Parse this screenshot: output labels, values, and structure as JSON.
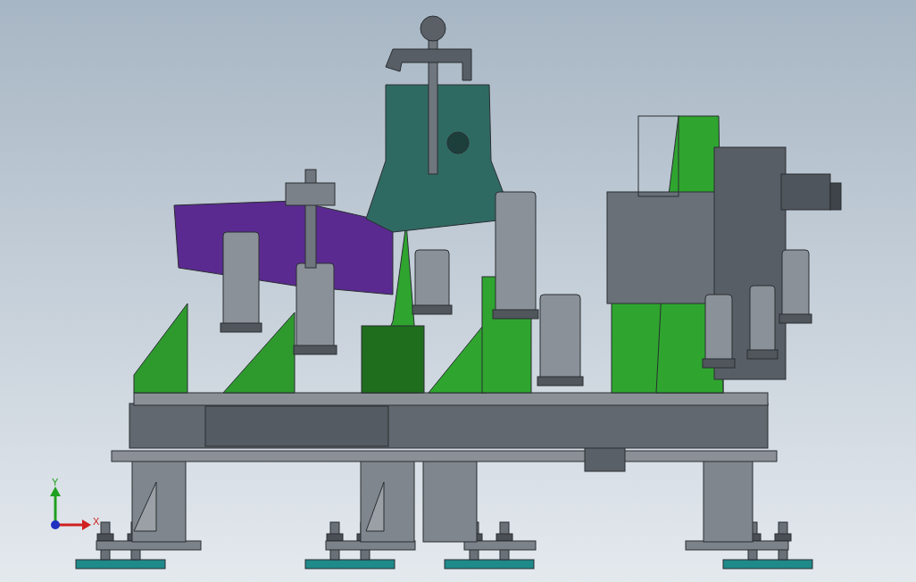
{
  "viewport": {
    "triad": {
      "axes": [
        {
          "label": "Y"
        },
        {
          "label": "X"
        }
      ]
    }
  }
}
